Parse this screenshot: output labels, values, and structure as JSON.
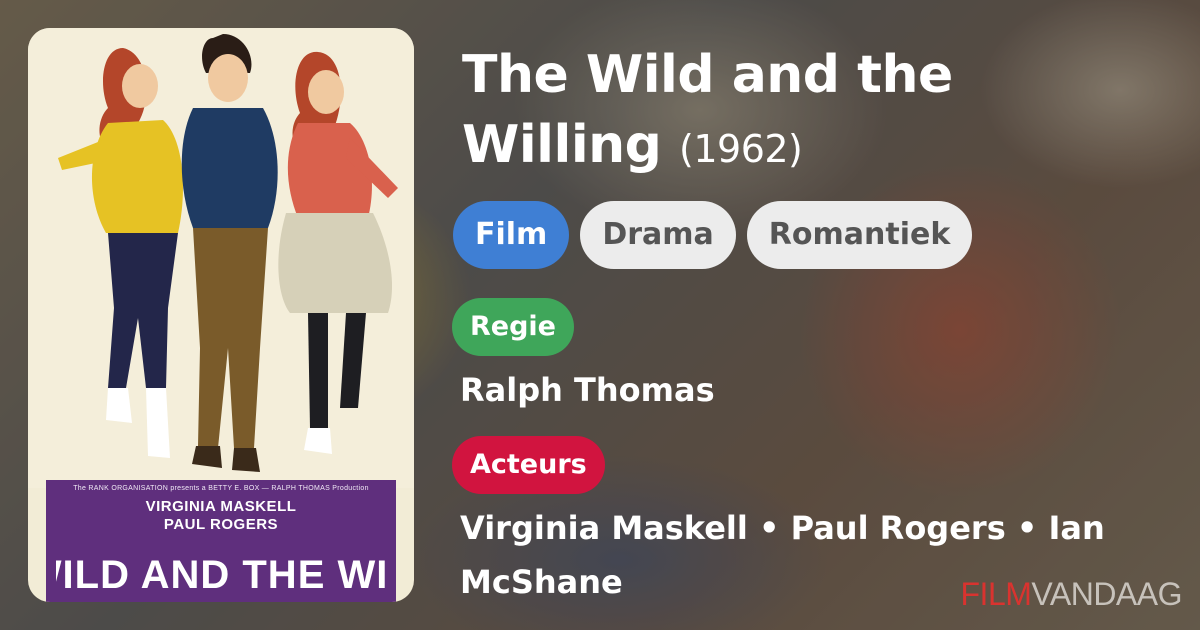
{
  "movie": {
    "title": "The Wild and the Willing",
    "year": "(1962)"
  },
  "tags": {
    "type": "Film",
    "genres": [
      "Drama",
      "Romantiek"
    ]
  },
  "credits": {
    "regie_label": "Regie",
    "regie_value": "Ralph Thomas",
    "acteurs_label": "Acteurs",
    "acteurs_value": "Virginia Maskell • Paul Rogers • Ian McShane"
  },
  "poster": {
    "presents_line": "The RANK ORGANISATION presents a BETTY E. BOX — RALPH THOMAS Production",
    "cast_line_1": "VIRGINIA MASKELL",
    "cast_line_2": "PAUL ROGERS",
    "title_art": "THE WILD AND THE WILLING"
  },
  "brand": {
    "part1": "FILM",
    "part2": "VANDAAG"
  },
  "colors": {
    "film_chip": "#3f7fd4",
    "regie_badge": "#3fa65a",
    "acteurs_badge": "#d1143f",
    "brand_red": "#d9332f"
  }
}
